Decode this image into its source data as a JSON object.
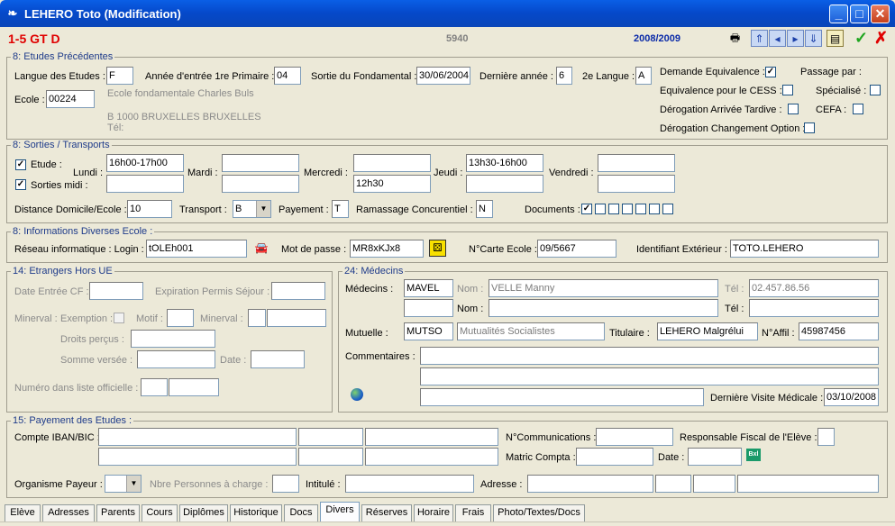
{
  "window": {
    "title": "LEHERO Toto (Modification)",
    "minimize": "_",
    "maximize": "□",
    "close": "✕"
  },
  "header": {
    "class": "1-5 GT D",
    "code": "5940",
    "year": "2008/2009",
    "accept": "✓",
    "cancel": "✗"
  },
  "etudes": {
    "title": "8: Etudes Précédentes",
    "langue_label": "Langue des Etudes :",
    "langue": "F",
    "annee_label": "Année d'entrée 1re Primaire :",
    "annee": "04",
    "sortie_label": "Sortie du Fondamental :",
    "sortie": "30/06/2004",
    "derniere_label": "Dernière année :",
    "derniere": "6",
    "langue2_label": "2e Langue :",
    "langue2": "A",
    "ecole_label": "Ecole :",
    "ecole": "00224",
    "ecole_nom": "Ecole fondamentale  Charles Buls",
    "ecole_adresse": "B  1000  BRUXELLES  BRUXELLES",
    "ecole_tel": "Tél:",
    "demande_label": "Demande Equivalence :",
    "passage_label": "Passage par :",
    "equiv_cess_label": "Equivalence pour le CESS :",
    "specialise_label": "Spécialisé :",
    "derog_arrivee_label": "Dérogation Arrivée Tardive :",
    "cefa_label": "CEFA  :",
    "derog_option_label": "Dérogation Changement Option :"
  },
  "sorties": {
    "title": "8: Sorties / Transports",
    "etude_label": "Etude :",
    "sorties_midi_label": "Sorties midi :",
    "lundi_label": "Lundi :",
    "mardi_label": "Mardi :",
    "mercredi_label": "Mercredi :",
    "jeudi_label": "Jeudi :",
    "vendredi_label": "Vendredi :",
    "lundi_1": "16h00-17h00",
    "mercredi_2": "12h30",
    "jeudi_1": "13h30-16h00",
    "distance_label": "Distance Domicile/Ecole :",
    "distance": "10",
    "transport_label": "Transport :",
    "transport": "B",
    "payement_label": "Payement :",
    "payement": "T",
    "ramassage_label": "Ramassage Concurentiel :",
    "ramassage": "N",
    "documents_label": "Documents :"
  },
  "infos": {
    "title": "8: Informations Diverses Ecole :",
    "login_label": "Réseau informatique : Login :",
    "login": "tOLEh001",
    "mdp_label": "Mot de passe :",
    "mdp": "MR8xKJx8",
    "carte_label": "N°Carte Ecole :",
    "carte": "09/5667",
    "ident_label": "Identifiant Extérieur :",
    "ident": "TOTO.LEHERO"
  },
  "etrangers": {
    "title": "14: Etrangers Hors UE",
    "date_cf_label": "Date Entrée CF :",
    "expiration_label": "Expiration Permis Séjour :",
    "minerval_label": "Minerval :",
    "exemption_label": "Exemption :",
    "motif_label": "Motif :",
    "minerval2_label": "Minerval :",
    "droits_label": "Droits perçus :",
    "somme_label": "Somme versée :",
    "date_label": "Date :",
    "numero_label": "Numéro dans liste officielle :"
  },
  "medecins": {
    "title": "24: Médecins",
    "medecins_label": "Médecins :",
    "med_code": "MAVEL",
    "nom_label": "Nom :",
    "med_nom": "VELLE Manny",
    "tel_label": "Tél :",
    "med_tel": "02.457.86.56",
    "nom2_label": "Nom :",
    "tel2_label": "Tél :",
    "mutuelle_label": "Mutuelle :",
    "mutuelle_code": "MUTSO",
    "mutuelle_nom": "Mutualités Socialistes",
    "titulaire_label": "Titulaire :",
    "titulaire": "LEHERO Malgrélui",
    "affil_label": "N°Affil :",
    "affil": "45987456",
    "commentaires_label": "Commentaires :",
    "visite_label": "Dernière Visite Médicale :",
    "visite": "03/10/2008"
  },
  "payement": {
    "title": "15: Payement des Etudes :",
    "iban_label": "Compte IBAN/BIC :",
    "ncomm_label": "N°Communications :",
    "resp_label": "Responsable Fiscal de l'Elève :",
    "matric_label": "Matric Compta :",
    "date_label": "Date :",
    "organisme_label": "Organisme Payeur :",
    "nbre_label": "Nbre Personnes à charge :",
    "intitule_label": "Intitulé :",
    "adresse_label": "Adresse :",
    "calc_label": "Bxl"
  },
  "tabs": [
    "Elève",
    "Adresses",
    "Parents",
    "Cours",
    "Diplômes",
    "Historique",
    "Docs",
    "Divers",
    "Réserves",
    "Horaire",
    "Frais",
    "Photo/Textes/Docs"
  ],
  "colors": {
    "accent_red": "#e00000",
    "title_blue": "#1e3b8a",
    "year_blue": "#0a2aa8"
  }
}
